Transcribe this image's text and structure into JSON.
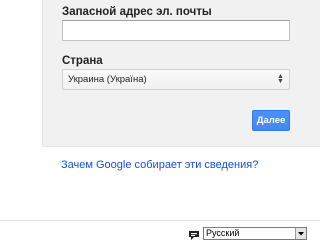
{
  "form": {
    "backup_email": {
      "label": "Запасной адрес эл. почты",
      "value": "",
      "placeholder": ""
    },
    "country": {
      "label": "Страна",
      "selected": "Украина (Україна)"
    },
    "next_button": "Далее"
  },
  "why_link": "Зачем Google собирает эти сведения?",
  "footer": {
    "language": "Русский"
  },
  "colors": {
    "card_background": "#f1f1f1",
    "primary_button": "#4d90fe",
    "link": "#1155cc"
  }
}
